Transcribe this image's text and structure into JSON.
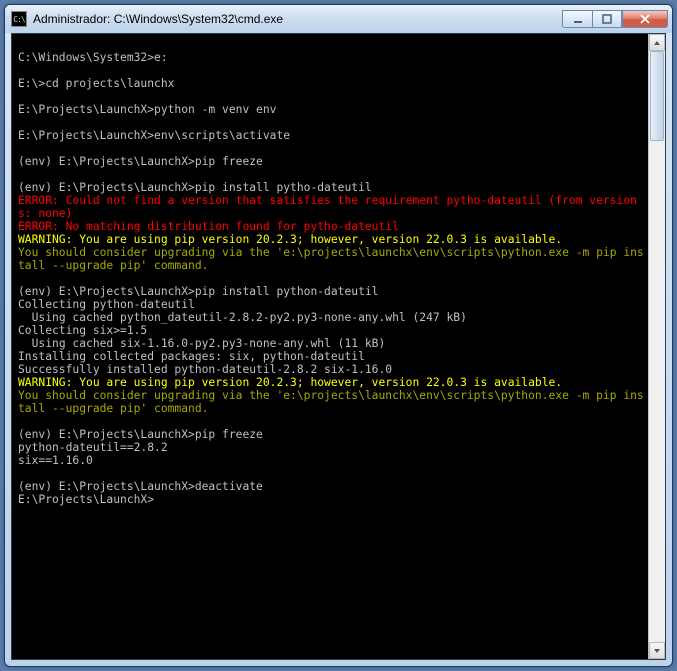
{
  "window": {
    "icon_label": "C:\\",
    "title": "Administrador: C:\\Windows\\System32\\cmd.exe"
  },
  "terminal": {
    "lines": [
      {
        "cls": "c-white",
        "text": ""
      },
      {
        "cls": "c-white",
        "text": "C:\\Windows\\System32>e:"
      },
      {
        "cls": "c-white",
        "text": ""
      },
      {
        "cls": "c-white",
        "text": "E:\\>cd projects\\launchx"
      },
      {
        "cls": "c-white",
        "text": ""
      },
      {
        "cls": "c-white",
        "text": "E:\\Projects\\LaunchX>python -m venv env"
      },
      {
        "cls": "c-white",
        "text": ""
      },
      {
        "cls": "c-white",
        "text": "E:\\Projects\\LaunchX>env\\scripts\\activate"
      },
      {
        "cls": "c-white",
        "text": ""
      },
      {
        "cls": "c-white",
        "text": "(env) E:\\Projects\\LaunchX>pip freeze"
      },
      {
        "cls": "c-white",
        "text": ""
      },
      {
        "cls": "c-white",
        "text": "(env) E:\\Projects\\LaunchX>pip install pytho-dateutil"
      },
      {
        "cls": "c-red",
        "text": "ERROR: Could not find a version that satisfies the requirement pytho-dateutil (from versions: none)"
      },
      {
        "cls": "c-red",
        "text": "ERROR: No matching distribution found for pytho-dateutil"
      },
      {
        "cls": "c-yellow",
        "text": "WARNING: You are using pip version 20.2.3; however, version 22.0.3 is available."
      },
      {
        "cls": "c-olive",
        "text": "You should consider upgrading via the 'e:\\projects\\launchx\\env\\scripts\\python.exe -m pip install --upgrade pip' command."
      },
      {
        "cls": "c-white",
        "text": ""
      },
      {
        "cls": "c-white",
        "text": "(env) E:\\Projects\\LaunchX>pip install python-dateutil"
      },
      {
        "cls": "c-white",
        "text": "Collecting python-dateutil"
      },
      {
        "cls": "c-white",
        "text": "  Using cached python_dateutil-2.8.2-py2.py3-none-any.whl (247 kB)"
      },
      {
        "cls": "c-white",
        "text": "Collecting six>=1.5"
      },
      {
        "cls": "c-white",
        "text": "  Using cached six-1.16.0-py2.py3-none-any.whl (11 kB)"
      },
      {
        "cls": "c-white",
        "text": "Installing collected packages: six, python-dateutil"
      },
      {
        "cls": "c-white",
        "text": "Successfully installed python-dateutil-2.8.2 six-1.16.0"
      },
      {
        "cls": "c-yellow",
        "text": "WARNING: You are using pip version 20.2.3; however, version 22.0.3 is available."
      },
      {
        "cls": "c-olive",
        "text": "You should consider upgrading via the 'e:\\projects\\launchx\\env\\scripts\\python.exe -m pip install --upgrade pip' command."
      },
      {
        "cls": "c-white",
        "text": ""
      },
      {
        "cls": "c-white",
        "text": "(env) E:\\Projects\\LaunchX>pip freeze"
      },
      {
        "cls": "c-white",
        "text": "python-dateutil==2.8.2"
      },
      {
        "cls": "c-white",
        "text": "six==1.16.0"
      },
      {
        "cls": "c-white",
        "text": ""
      },
      {
        "cls": "c-white",
        "text": "(env) E:\\Projects\\LaunchX>deactivate"
      },
      {
        "cls": "c-white",
        "text": "E:\\Projects\\LaunchX>"
      }
    ]
  }
}
